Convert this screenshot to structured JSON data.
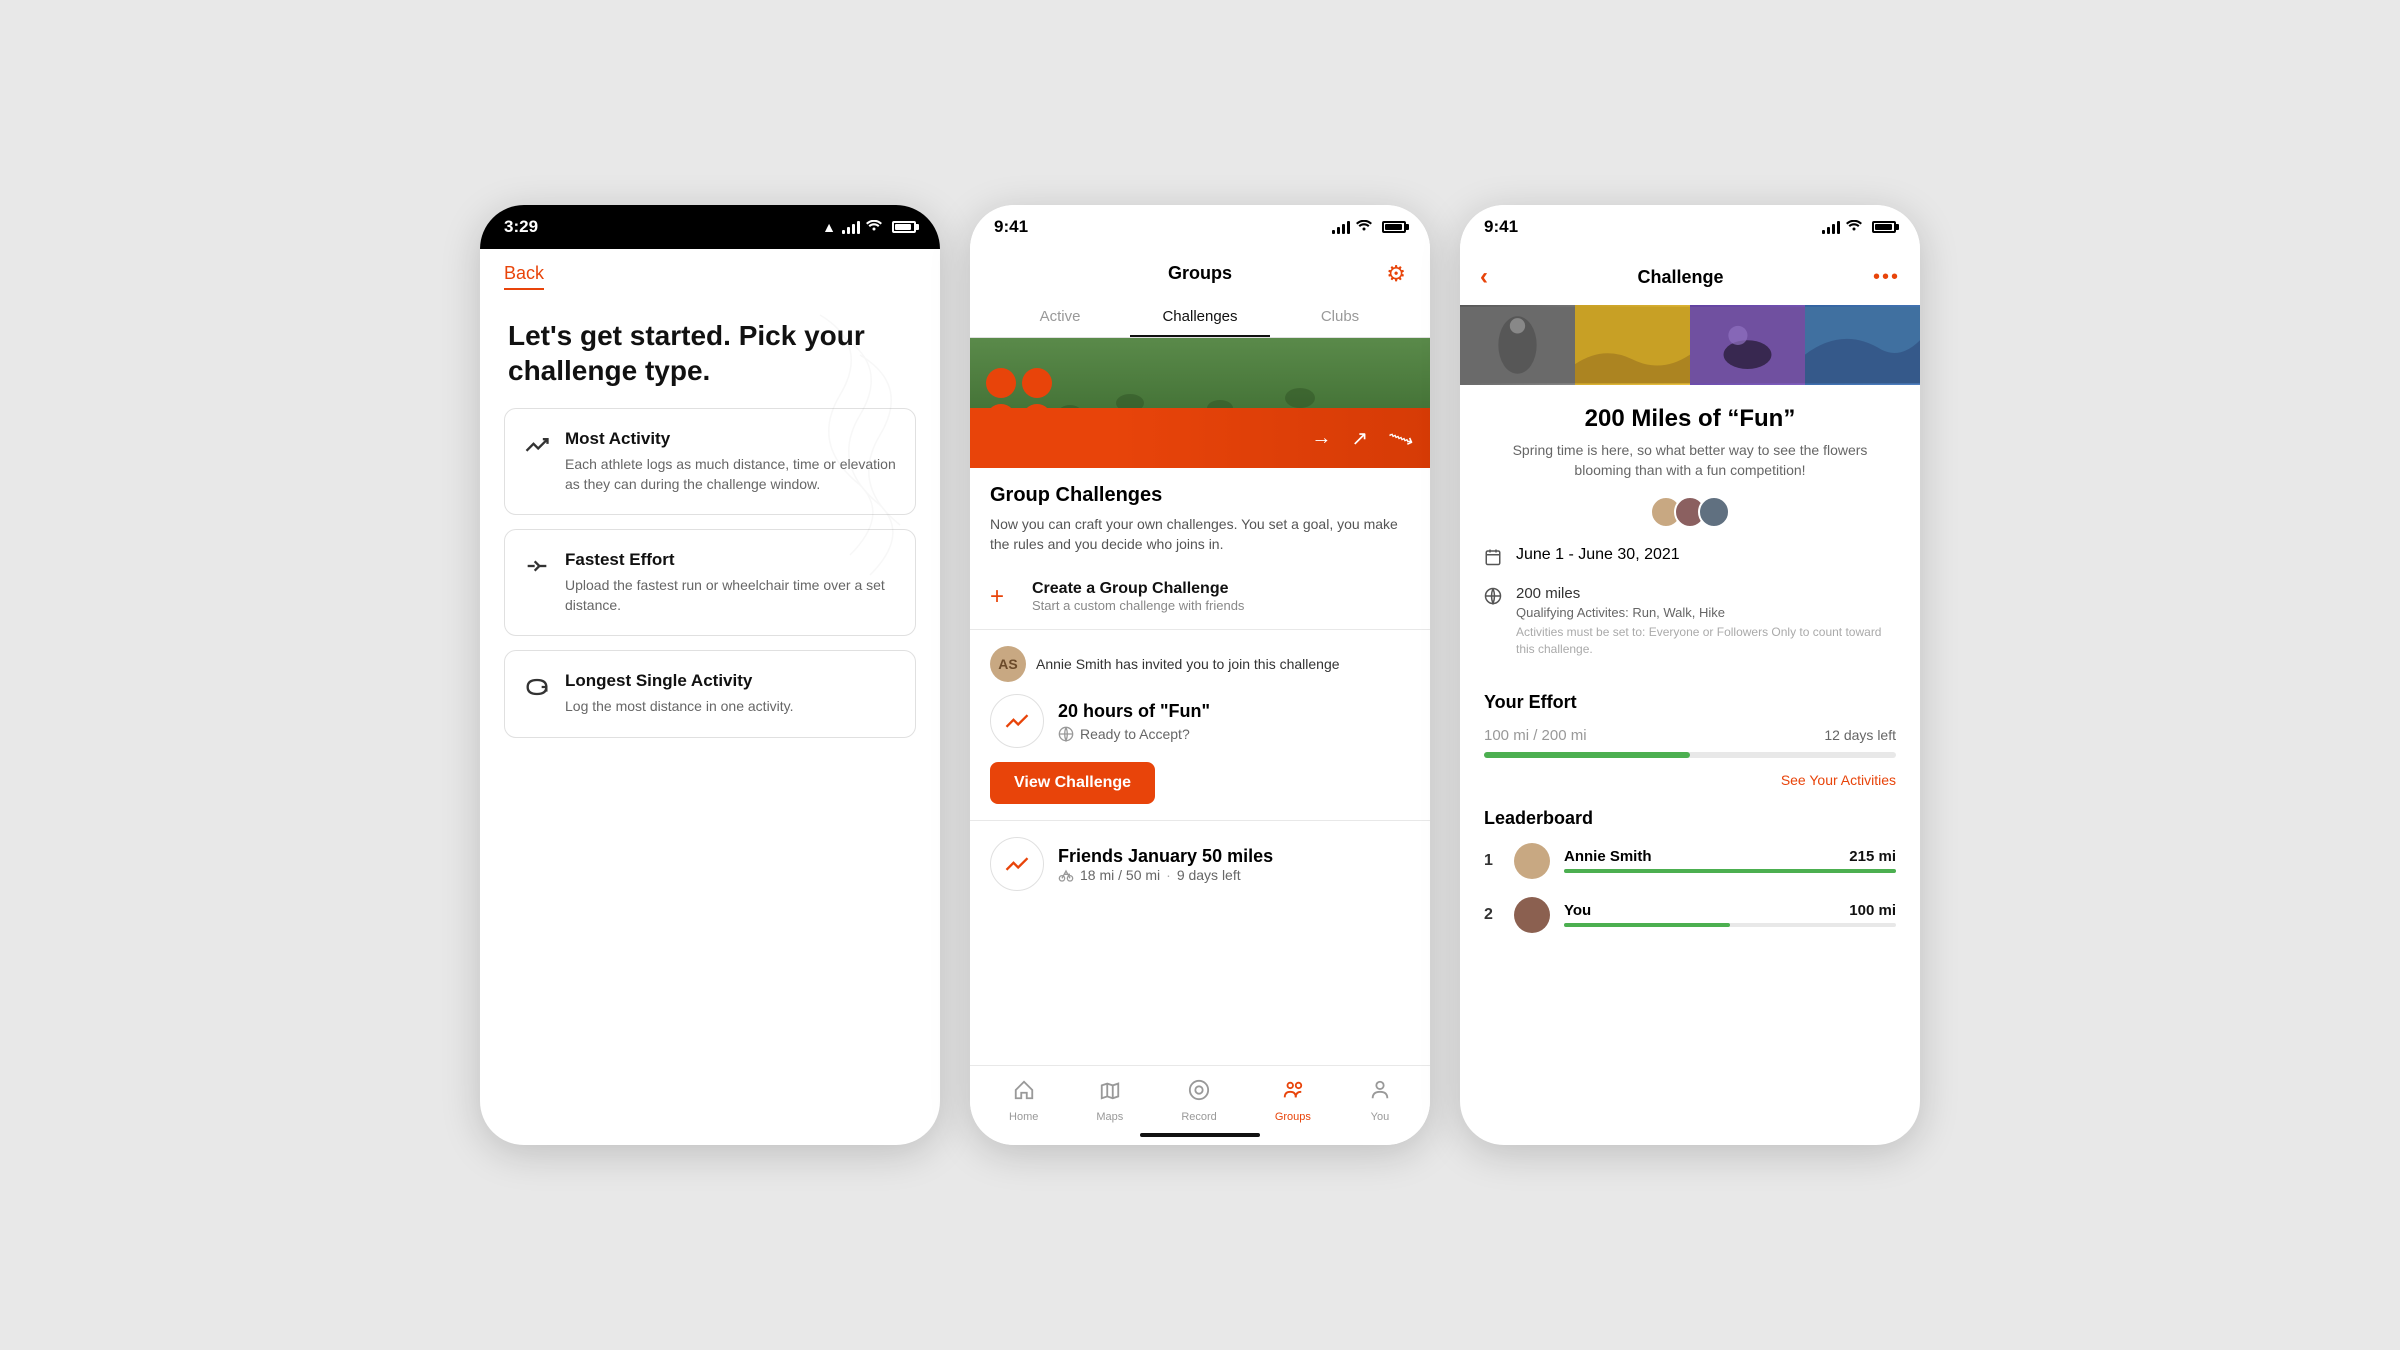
{
  "phone1": {
    "status": {
      "time": "3:29",
      "location": true
    },
    "back": "Back",
    "heading": "Let's get started. Pick your challenge type.",
    "options": [
      {
        "id": "most-activity",
        "title": "Most Activity",
        "desc": "Each athlete logs as much distance, time or elevation as they can during the challenge window.",
        "icon": "trending-up"
      },
      {
        "id": "fastest-effort",
        "title": "Fastest Effort",
        "desc": "Upload the fastest run or wheelchair time over a set distance.",
        "icon": "speed"
      },
      {
        "id": "longest-single",
        "title": "Longest Single Activity",
        "desc": "Log the most distance in one activity.",
        "icon": "loop"
      }
    ]
  },
  "phone2": {
    "status": {
      "time": "9:41"
    },
    "header": {
      "title": "Groups"
    },
    "tabs": [
      "Active",
      "Challenges",
      "Clubs"
    ],
    "active_tab": "Active",
    "group_challenges": {
      "title": "Group Challenges",
      "desc": "Now you can craft your own challenges. You set a goal, you make the rules and you decide who joins in."
    },
    "create": {
      "title": "Create a Group Challenge",
      "subtitle": "Start a custom challenge with friends"
    },
    "invite": {
      "from": "Annie Smith",
      "invite_text": "Annie Smith has invited you to join this challenge",
      "challenge_name": "20 hours of \"Fun\"",
      "challenge_sub": "Ready to Accept?",
      "btn": "View Challenge"
    },
    "friends_challenge": {
      "title": "Friends January 50 miles",
      "progress": "18 mi",
      "total": "50 mi",
      "days": "9 days left"
    },
    "nav": {
      "items": [
        {
          "label": "Home",
          "icon": "home",
          "active": false
        },
        {
          "label": "Maps",
          "icon": "map",
          "active": false
        },
        {
          "label": "Record",
          "icon": "record",
          "active": false
        },
        {
          "label": "Groups",
          "icon": "groups",
          "active": true
        },
        {
          "label": "You",
          "icon": "person",
          "active": false
        }
      ]
    }
  },
  "phone3": {
    "status": {
      "time": "9:41"
    },
    "header": {
      "title": "Challenge"
    },
    "challenge": {
      "name": "200 Miles of “Fun”",
      "tagline": "Spring time is here, so what better way to see the flowers blooming than with a fun competition!",
      "date_range": "June 1 - June 30, 2021",
      "distance": "200 miles",
      "qualifying": "Qualifying Activites: Run, Walk, Hike",
      "note": "Activities must be set to: Everyone or Followers Only to count toward this challenge."
    },
    "your_effort": {
      "label": "Your Effort",
      "current": "100 mi",
      "total": "200 mi",
      "days_left": "12 days left",
      "progress_pct": 50,
      "see_activities": "See Your Activities"
    },
    "leaderboard": {
      "label": "Leaderboard",
      "entries": [
        {
          "rank": 1,
          "name": "Annie Smith",
          "distance": "215 mi",
          "progress_pct": 100
        },
        {
          "rank": 2,
          "name": "You",
          "distance": "100 mi",
          "progress_pct": 50
        }
      ]
    }
  }
}
